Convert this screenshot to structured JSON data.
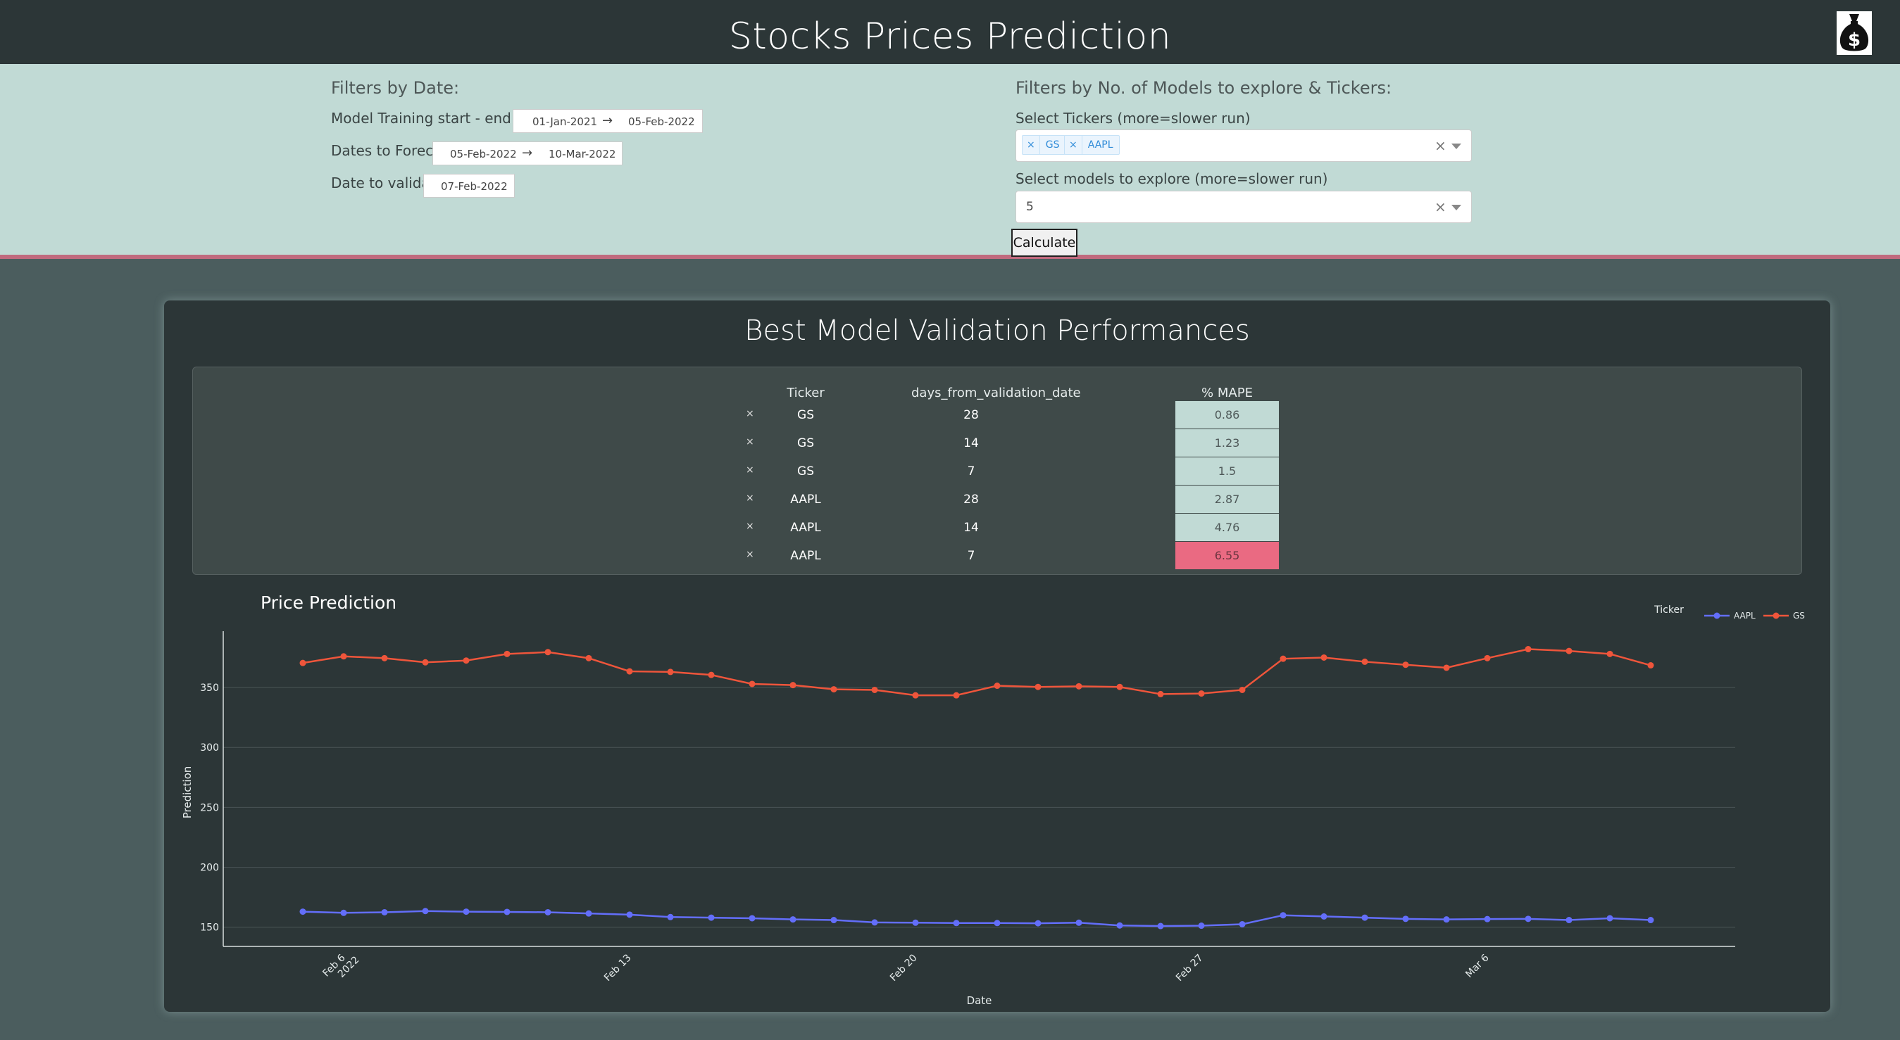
{
  "header": {
    "title": "Stocks Prices Prediction",
    "logo_icon": "money-bag-dollar-icon"
  },
  "filters": {
    "date_heading": "Filters by Date:",
    "training_label": "Model Training start - end dates:",
    "training_start": "01-Jan-2021",
    "training_end": "05-Feb-2022",
    "forecast_label": "Dates to Forecast:",
    "forecast_start": "05-Feb-2022",
    "forecast_end": "10-Mar-2022",
    "validate_label": "Date to validate:",
    "validate_date": "07-Feb-2022",
    "arrow": "→",
    "models_heading": "Filters by No. of Models to explore & Tickers:",
    "tickers_label": "Select Tickers (more=slower run)",
    "selected_tickers": [
      "GS",
      "AAPL"
    ],
    "models_label": "Select models to explore (more=slower run)",
    "models_value": "5",
    "remove_symbol": "×",
    "calculate_label": "Calculate"
  },
  "performance": {
    "title": "Best Model Validation Performances",
    "columns": [
      "Ticker",
      "days_from_validation_date",
      "% MAPE"
    ],
    "rows": [
      {
        "ticker": "GS",
        "days": "28",
        "mape": "0.86"
      },
      {
        "ticker": "GS",
        "days": "14",
        "mape": "1.23"
      },
      {
        "ticker": "GS",
        "days": "7",
        "mape": "1.5"
      },
      {
        "ticker": "AAPL",
        "days": "28",
        "mape": "2.87"
      },
      {
        "ticker": "AAPL",
        "days": "14",
        "mape": "4.76"
      },
      {
        "ticker": "AAPL",
        "days": "7",
        "mape": "6.55"
      }
    ],
    "highlight_color": "#ea6a82",
    "normal_color": "#c1dad5"
  },
  "chart_data": {
    "type": "line",
    "title": "Price Prediction",
    "xlabel": "Date",
    "ylabel": "Prediction",
    "legend_title": "Ticker",
    "legend_position": "top-right",
    "grid": true,
    "x_start": "2022-02-05",
    "x": [
      "2022-02-05",
      "2022-02-06",
      "2022-02-07",
      "2022-02-08",
      "2022-02-09",
      "2022-02-10",
      "2022-02-11",
      "2022-02-12",
      "2022-02-13",
      "2022-02-14",
      "2022-02-15",
      "2022-02-16",
      "2022-02-17",
      "2022-02-18",
      "2022-02-19",
      "2022-02-20",
      "2022-02-21",
      "2022-02-22",
      "2022-02-23",
      "2022-02-24",
      "2022-02-25",
      "2022-02-26",
      "2022-02-27",
      "2022-02-28",
      "2022-03-01",
      "2022-03-02",
      "2022-03-03",
      "2022-03-04",
      "2022-03-05",
      "2022-03-06",
      "2022-03-07",
      "2022-03-08",
      "2022-03-09",
      "2022-03-10"
    ],
    "x_ticks": [
      {
        "date": "2022-02-06",
        "label": "Feb 6",
        "sub": "2022"
      },
      {
        "date": "2022-02-13",
        "label": "Feb 13",
        "sub": ""
      },
      {
        "date": "2022-02-20",
        "label": "Feb 20",
        "sub": ""
      },
      {
        "date": "2022-02-27",
        "label": "Feb 27",
        "sub": ""
      },
      {
        "date": "2022-03-06",
        "label": "Mar 6",
        "sub": ""
      }
    ],
    "y_ticks": [
      150,
      200,
      250,
      300,
      350
    ],
    "ylim": [
      134,
      397
    ],
    "series": [
      {
        "name": "AAPL",
        "color": "#636efa",
        "values": [
          163,
          162,
          162.5,
          163.5,
          163,
          162.8,
          162.5,
          161.5,
          160.5,
          158.5,
          158,
          157.5,
          156.5,
          156,
          154,
          153.8,
          153.5,
          153.5,
          153.3,
          153.8,
          151.5,
          151,
          151.3,
          152.5,
          160,
          159,
          158,
          157,
          156.5,
          156.8,
          157,
          156,
          157.5,
          156
        ]
      },
      {
        "name": "GS",
        "color": "#ef553b",
        "values": [
          370.5,
          376,
          374.5,
          371,
          372.5,
          378,
          379.5,
          374.5,
          363.5,
          363,
          360.5,
          353,
          352,
          348.5,
          348,
          343.5,
          343.5,
          351.5,
          350.5,
          351,
          350.5,
          344.5,
          345,
          348,
          374,
          375,
          371.5,
          369,
          366.5,
          374.5,
          382,
          380.5,
          378,
          368.5
        ]
      }
    ]
  }
}
